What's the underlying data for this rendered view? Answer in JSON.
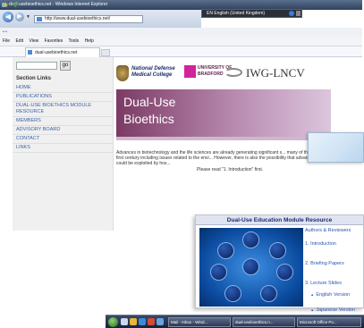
{
  "browser": {
    "window_title": "dual-usebioethics.net - Windows Internet Explorer",
    "language_bar": "EN English (United Kingdom)",
    "address": "http://www.dual-usebioethics.net/",
    "menu": [
      "File",
      "Edit",
      "View",
      "Favorites",
      "Tools",
      "Help"
    ],
    "tab_title": "dual-usebioethics.net"
  },
  "sidebar": {
    "search_button": "go",
    "section_title": "Section Links",
    "links": [
      "HOME",
      "PUBLICATIONS",
      "DUAL-USE BIOETHICS MODULE RESOURCE",
      "MEMBERS",
      "ADVISORY BOARD",
      "CONTACT",
      "LINKS"
    ]
  },
  "header": {
    "ndmc_line1": "National Defense",
    "ndmc_line2": "Medical College",
    "bradford_line1": "UNIVERSITY OF",
    "bradford_line2": "BRADFORD",
    "iwg": "IWG-LNCV"
  },
  "banner": {
    "line1": "Dual-Use",
    "line2": "Bioethics"
  },
  "intro": {
    "text": "Advances in biotechnology and the life sciences are already generating significant s... many of the challenges in the twenty first century including issues related to the envi... However, there is also the possibility that advances in the life sciences could be exploited by hos...",
    "read_more": "Please read \"1. Introduction\" first."
  },
  "module": {
    "title": "Dual-Use Education Module Resource",
    "nav": {
      "authors": "Authors & Reviewers",
      "intro": "1. Introduction",
      "briefing": "2. Briefing Papers",
      "lecture": "3. Lecture Slides",
      "english": "English Version",
      "japanese": "Japanese Version"
    }
  },
  "taskbar": {
    "tasks": [
      "Mail - Inbox - Wind...",
      "dual-usebioethics.n...",
      "Microsoft Office Po..."
    ]
  },
  "colors": {
    "link": "#3a63a6",
    "banner": "#7b3a64",
    "module_title": "#1c2a73",
    "nav": "#2a56b0"
  }
}
